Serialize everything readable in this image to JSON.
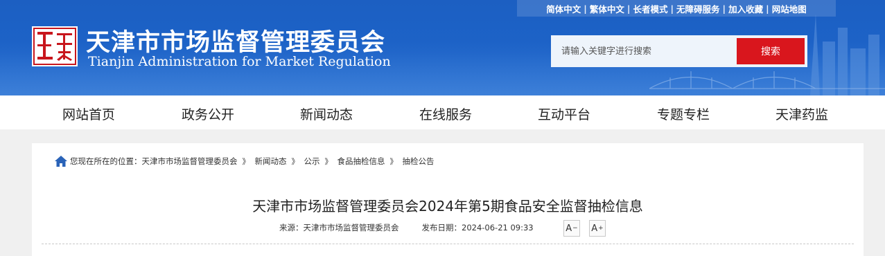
{
  "header": {
    "title_cn": "天津市市场监督管理委员会",
    "title_en": "Tianjin Administration for Market Regulation",
    "logo_icon": "tianjin-seal-icon",
    "top_links": [
      "简体中文",
      "繁体中文",
      "长者模式",
      "无障碍服务",
      "加入收藏",
      "网站地图"
    ],
    "search": {
      "placeholder": "请输入关键字进行搜索",
      "button_label": "搜索"
    }
  },
  "nav": {
    "items": [
      "网站首页",
      "政务公开",
      "新闻动态",
      "在线服务",
      "互动平台",
      "专题专栏",
      "天津药监"
    ]
  },
  "breadcrumb": {
    "home_icon": "home-icon",
    "prefix": "您现在所在的位置：",
    "items": [
      "天津市市场监督管理委员会",
      "新闻动态",
      "公示",
      "食品抽检信息",
      "抽检公告"
    ],
    "separator": "》"
  },
  "article": {
    "title": "天津市市场监督管理委员会2024年第5期食品安全监督抽检信息",
    "source": "来源：天津市市场监督管理委员会",
    "date": "发布日期：2024-06-21 09:33",
    "font_decrease_label": "A",
    "font_decrease_sup": "−",
    "font_increase_label": "A",
    "font_increase_sup": "+"
  },
  "colors": {
    "header_blue": "#1d63c8",
    "search_button_red": "#d9161d",
    "seal_red": "#c8161d"
  }
}
